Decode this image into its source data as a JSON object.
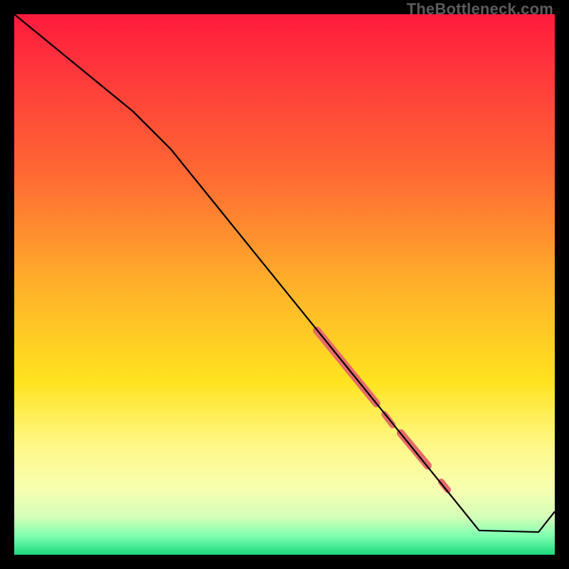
{
  "watermark": "TheBottleneck.com",
  "chart_data": {
    "type": "line",
    "title": "",
    "xlabel": "",
    "ylabel": "",
    "xlim": [
      0,
      100
    ],
    "ylim": [
      0,
      100
    ],
    "background_gradient": {
      "stops": [
        {
          "pos": 0.0,
          "color": "#ff1a3d"
        },
        {
          "pos": 0.12,
          "color": "#ff3b3b"
        },
        {
          "pos": 0.3,
          "color": "#ff6a33"
        },
        {
          "pos": 0.5,
          "color": "#ffb02a"
        },
        {
          "pos": 0.68,
          "color": "#ffe31f"
        },
        {
          "pos": 0.8,
          "color": "#fff88a"
        },
        {
          "pos": 0.88,
          "color": "#f7ffb0"
        },
        {
          "pos": 0.93,
          "color": "#d4ffb8"
        },
        {
          "pos": 0.965,
          "color": "#7fffb0"
        },
        {
          "pos": 1.0,
          "color": "#1bd97e"
        }
      ]
    },
    "series": [
      {
        "name": "curve",
        "x": [
          0.0,
          22.0,
          29.0,
          86.0,
          97.0,
          100.0
        ],
        "y": [
          100.0,
          82.0,
          75.0,
          4.5,
          4.2,
          8.0
        ]
      }
    ],
    "highlight_segments": [
      {
        "x0": 56.0,
        "y0": 41.5,
        "x1": 67.0,
        "y1": 28.0,
        "w": 11
      },
      {
        "x0": 68.5,
        "y0": 26.0,
        "x1": 70.0,
        "y1": 24.0,
        "w": 9
      },
      {
        "x0": 71.5,
        "y0": 22.5,
        "x1": 76.5,
        "y1": 16.5,
        "w": 11
      },
      {
        "x0": 79.0,
        "y0": 13.5,
        "x1": 80.2,
        "y1": 12.0,
        "w": 9
      }
    ],
    "highlight_color": "#e86a6a"
  }
}
